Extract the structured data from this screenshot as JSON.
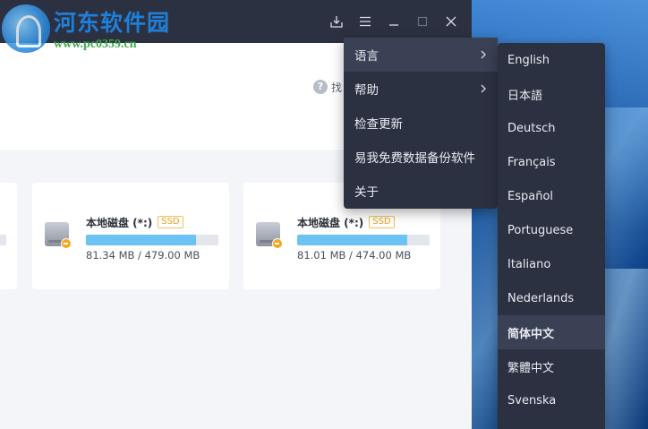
{
  "watermark": {
    "title": "河东软件园",
    "url": "www.pc0359.cn"
  },
  "titlebar": {
    "buttons": [
      "download-icon",
      "menu-icon",
      "minimize-icon",
      "maximize-icon",
      "close-icon"
    ]
  },
  "header": {
    "help_label": "找"
  },
  "disks": [
    {
      "name": "本地磁盘 (*:)",
      "badge": "SSD",
      "usage": "81.34 MB / 479.00 MB",
      "fill_fraction": 0.83
    },
    {
      "name": "本地磁盘 (*:)",
      "badge": "SSD",
      "usage": "81.01 MB / 474.00 MB",
      "fill_fraction": 0.83
    }
  ],
  "menu": {
    "items": [
      {
        "label": "语言",
        "has_submenu": true,
        "active": true
      },
      {
        "label": "帮助",
        "has_submenu": true,
        "active": false
      },
      {
        "label": "检查更新",
        "has_submenu": false,
        "active": false
      },
      {
        "label": "易我免费数据备份软件",
        "has_submenu": false,
        "active": false
      },
      {
        "label": "关于",
        "has_submenu": false,
        "active": false
      }
    ]
  },
  "languages": {
    "items": [
      "English",
      "日本語",
      "Deutsch",
      "Français",
      "Español",
      "Portuguese",
      "Italiano",
      "Nederlands",
      "简体中文",
      "繁體中文",
      "Svenska"
    ],
    "selected": "简体中文"
  },
  "colors": {
    "menu_bg": "#2c3142",
    "menu_active": "#3b4155",
    "usage_fill": "#6cc3f3",
    "ssd_badge": "#e7a11b"
  }
}
